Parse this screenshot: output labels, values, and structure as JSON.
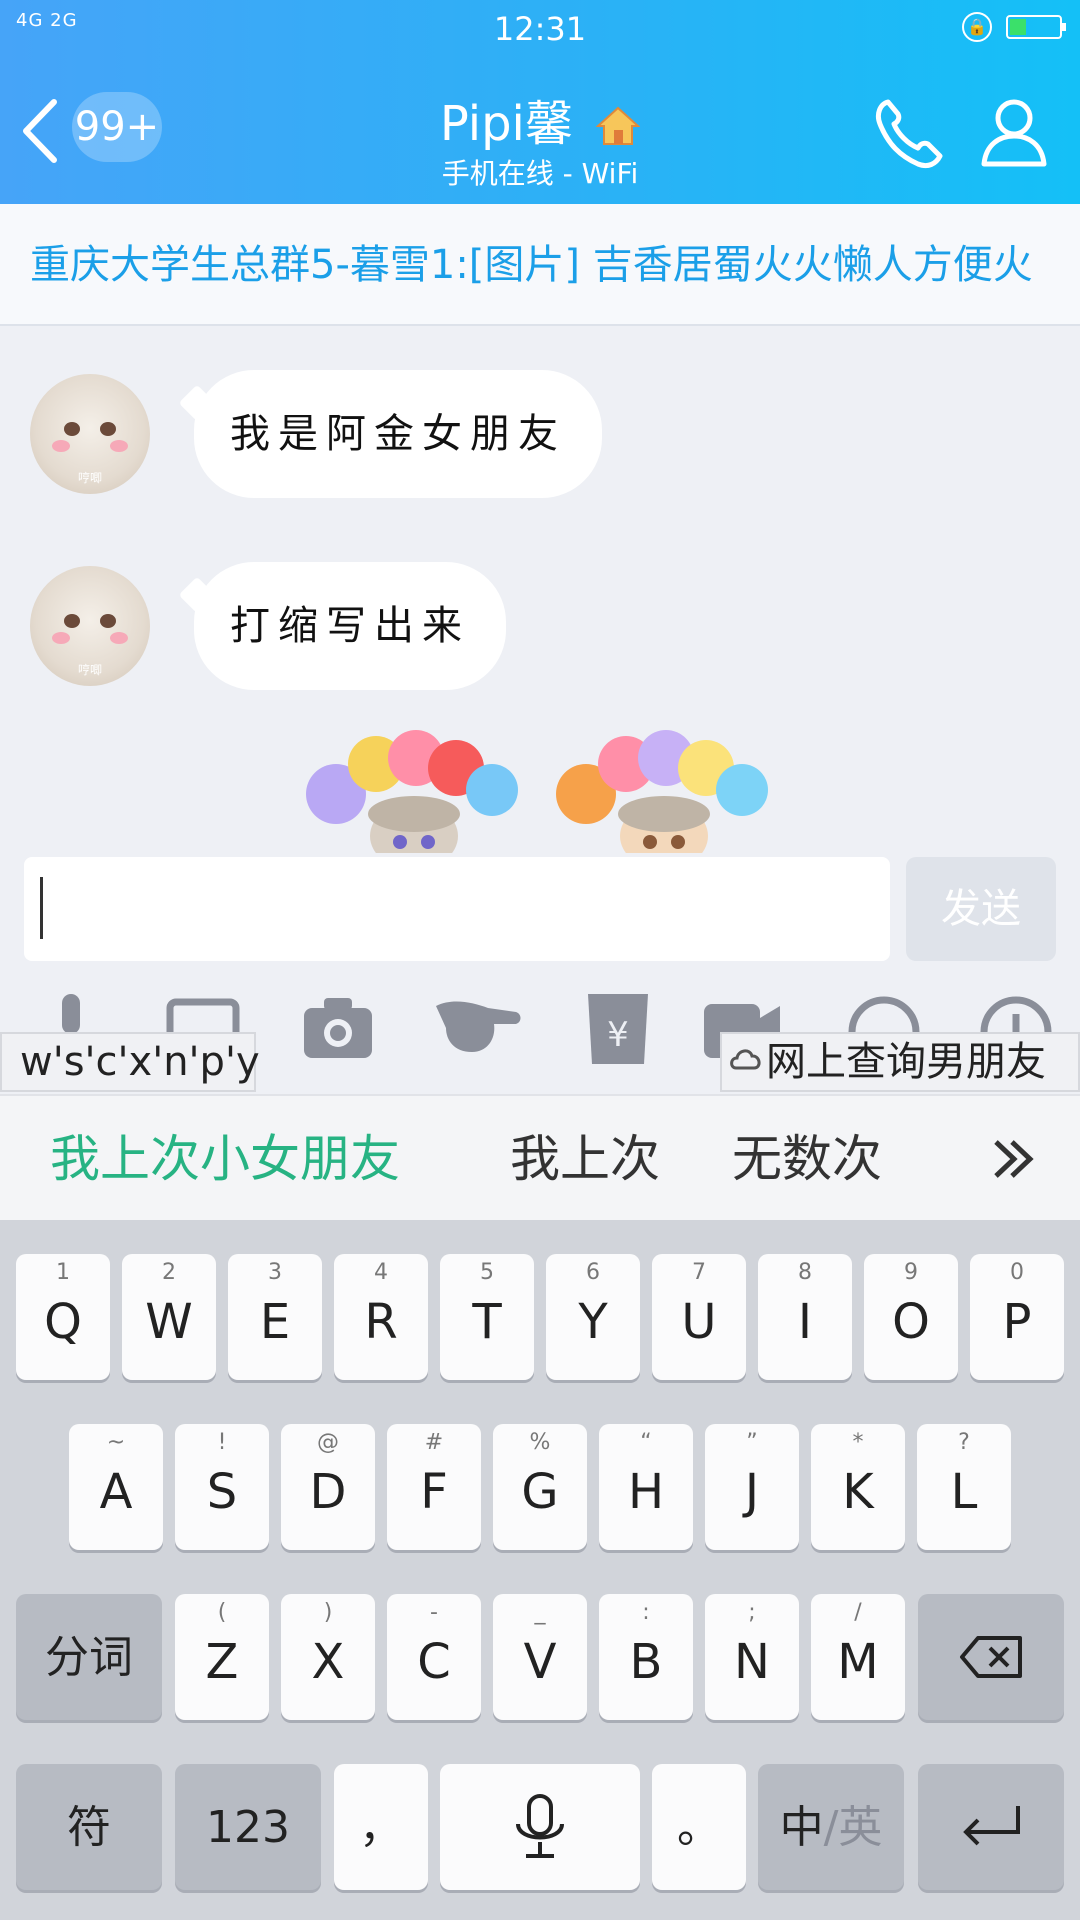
{
  "status_bar": {
    "left": "4G 2G",
    "time": "12:31"
  },
  "header": {
    "back_count": "99+",
    "title": "Pipi馨",
    "subtitle": "手机在线 - WiFi"
  },
  "notice": {
    "text": "重庆大学生总群5-暮雪1:[图片] 吉香居蜀火火懒人方便火"
  },
  "messages": [
    {
      "avatar_tag": "哼唧",
      "text": "我是阿金女朋友"
    },
    {
      "avatar_tag": "哼唧",
      "text": "打缩写出来"
    }
  ],
  "composer": {
    "input_value": "",
    "send_label": "发送"
  },
  "ime": {
    "composing": "w's'c'x'n'p'y",
    "cloud_suggestion": "网上查询男朋友",
    "candidates": [
      "我上次小女朋友",
      "我上次",
      "无数次"
    ]
  },
  "keyboard": {
    "row1": [
      {
        "sub": "1",
        "main": "Q"
      },
      {
        "sub": "2",
        "main": "W"
      },
      {
        "sub": "3",
        "main": "E"
      },
      {
        "sub": "4",
        "main": "R"
      },
      {
        "sub": "5",
        "main": "T"
      },
      {
        "sub": "6",
        "main": "Y"
      },
      {
        "sub": "7",
        "main": "U"
      },
      {
        "sub": "8",
        "main": "I"
      },
      {
        "sub": "9",
        "main": "O"
      },
      {
        "sub": "0",
        "main": "P"
      }
    ],
    "row2": [
      {
        "sub": "~",
        "main": "A"
      },
      {
        "sub": "!",
        "main": "S"
      },
      {
        "sub": "@",
        "main": "D"
      },
      {
        "sub": "#",
        "main": "F"
      },
      {
        "sub": "%",
        "main": "G"
      },
      {
        "sub": "“",
        "main": "H"
      },
      {
        "sub": "”",
        "main": "J"
      },
      {
        "sub": "*",
        "main": "K"
      },
      {
        "sub": "?",
        "main": "L"
      }
    ],
    "row3": [
      {
        "sub": "(",
        "main": "Z"
      },
      {
        "sub": ")",
        "main": "X"
      },
      {
        "sub": "-",
        "main": "C"
      },
      {
        "sub": "_",
        "main": "V"
      },
      {
        "sub": ":",
        "main": "B"
      },
      {
        "sub": ";",
        "main": "N"
      },
      {
        "sub": "/",
        "main": "M"
      }
    ],
    "segment_label": "分词",
    "symbol_label": "符",
    "numbers_label": "123",
    "comma_label": "，",
    "period_label": "。",
    "lang_label_cn": "中",
    "lang_label_en": "/英"
  },
  "colors": {
    "header_start": "#46a4f8",
    "header_end": "#14c0f7",
    "notice_text": "#1b9fe8",
    "candidate_highlight": "#27b383"
  }
}
